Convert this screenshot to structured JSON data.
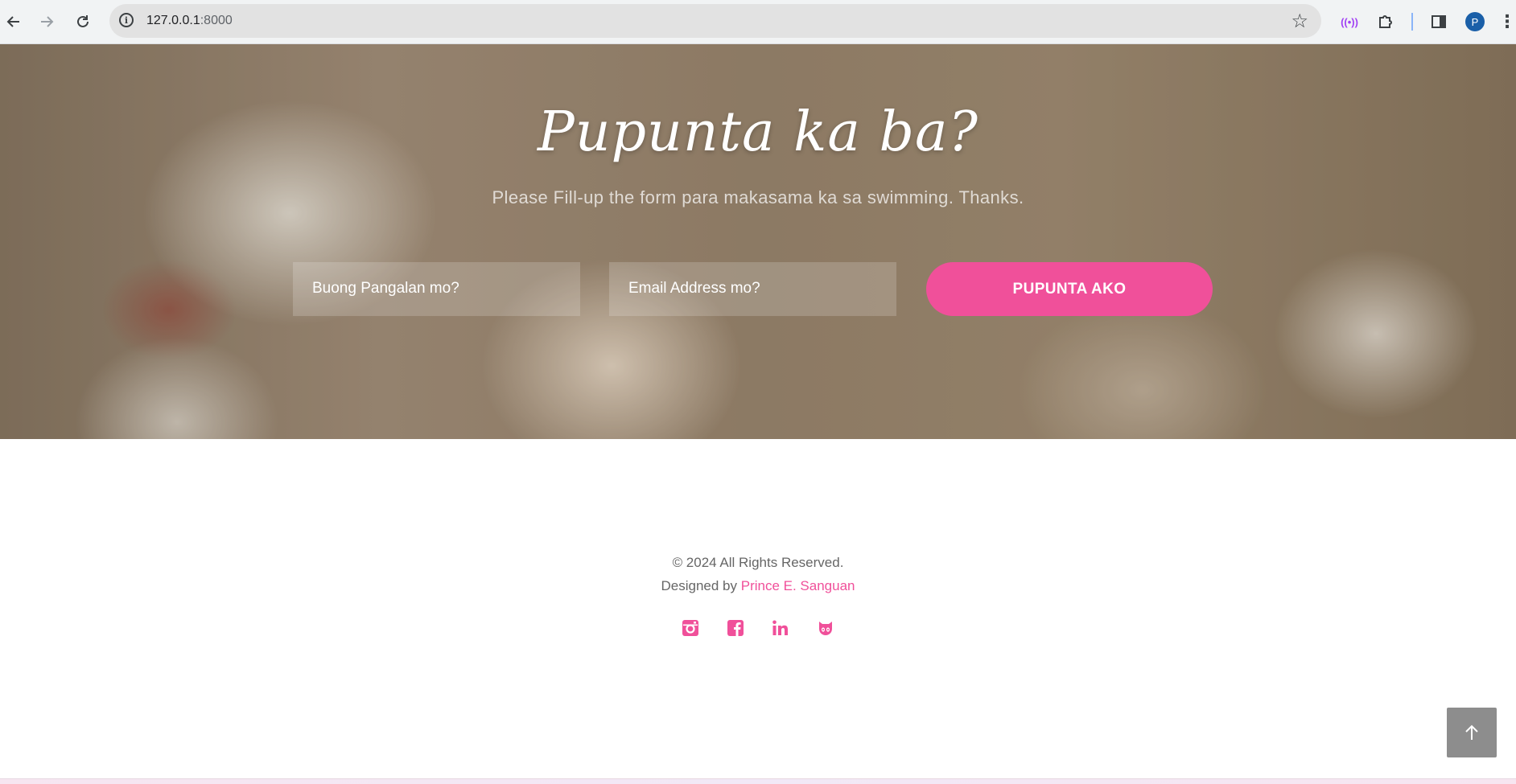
{
  "browser": {
    "url_host": "127.0.0.1",
    "url_port": ":8000",
    "profile_initial": "P"
  },
  "hero": {
    "title": "Pupunta ka ba?",
    "subtitle": "Please Fill-up the form para makasama ka sa swimming. Thanks.",
    "name_placeholder": "Buong Pangalan mo?",
    "email_placeholder": "Email Address mo?",
    "submit_label": "PUPUNTA AKO"
  },
  "footer": {
    "copyright": "© 2024 All Rights Reserved.",
    "designed_prefix": "Designed by",
    "designer_name": "Prince E. Sanguan",
    "socials": [
      "instagram-icon",
      "facebook-icon",
      "linkedin-icon",
      "github-icon"
    ]
  },
  "colors": {
    "accent": "#f0509a",
    "back_to_top": "#8d8d8d"
  }
}
